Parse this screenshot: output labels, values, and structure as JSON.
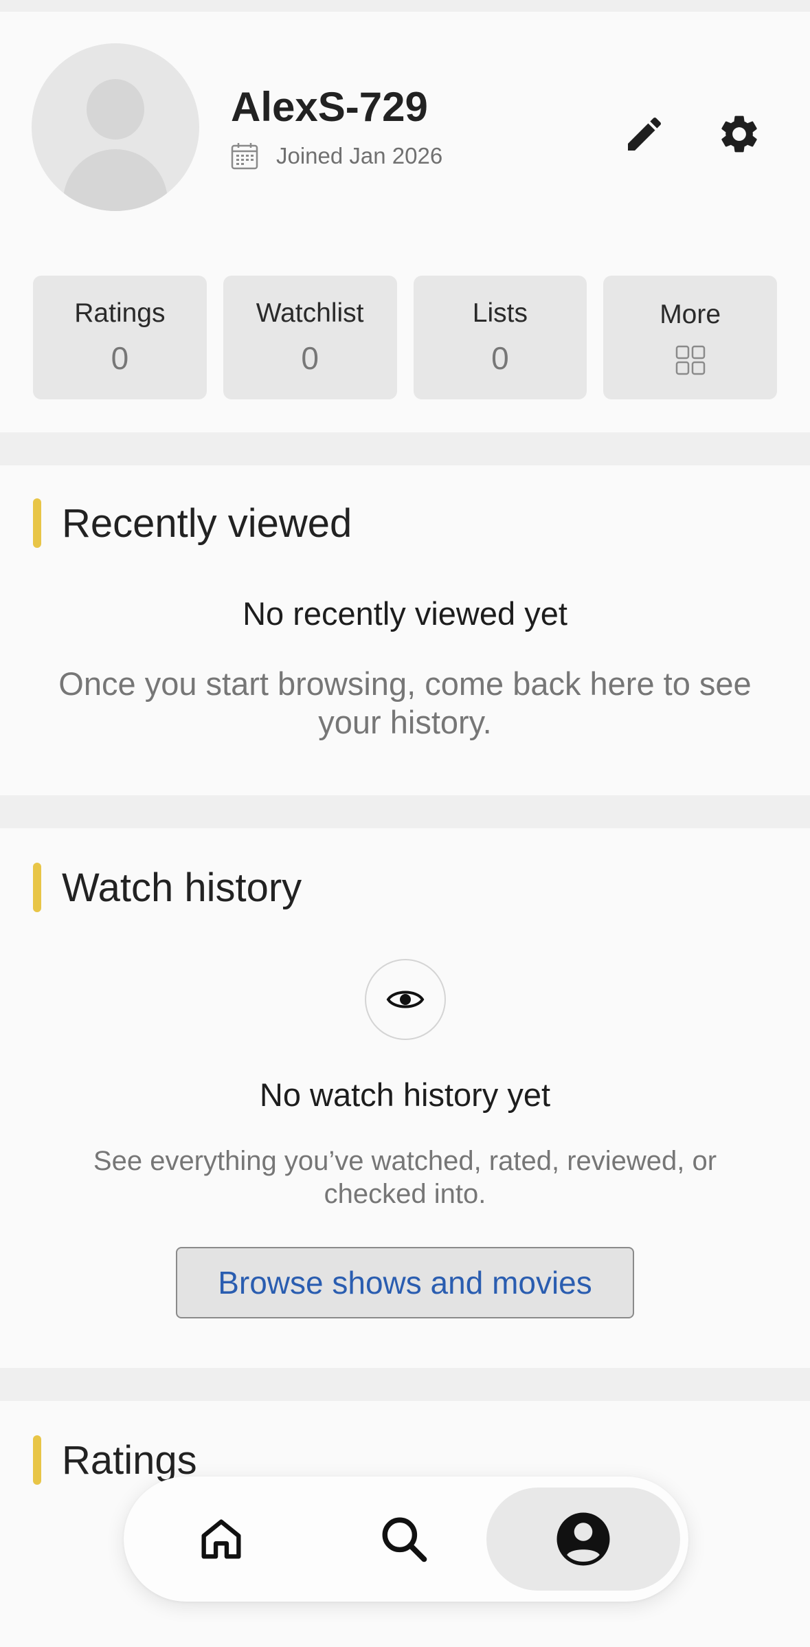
{
  "profile": {
    "username": "AlexS-729",
    "joined": "Joined Jan 2026",
    "icons": {
      "avatar": "person-placeholder-icon",
      "calendar": "calendar-icon",
      "edit": "pencil-icon",
      "settings": "gear-icon"
    }
  },
  "stats": [
    {
      "label": "Ratings",
      "value": "0"
    },
    {
      "label": "Watchlist",
      "value": "0"
    },
    {
      "label": "Lists",
      "value": "0"
    },
    {
      "label": "More",
      "icon": "grid-icon"
    }
  ],
  "recently_viewed": {
    "title": "Recently viewed",
    "empty_title": "No recently viewed yet",
    "empty_desc": "Once you start browsing, come back here to see your history."
  },
  "watch_history": {
    "title": "Watch history",
    "icon": "eye-icon",
    "empty_title": "No watch history yet",
    "empty_desc": "See everything you’ve watched, rated, reviewed, or checked into.",
    "button_label": "Browse shows and movies"
  },
  "ratings_section": {
    "title": "Ratings"
  },
  "bottom_nav": {
    "items": [
      {
        "name": "home",
        "icon": "home-icon"
      },
      {
        "name": "search",
        "icon": "search-icon"
      },
      {
        "name": "profile",
        "icon": "account-circle-icon",
        "active": true
      }
    ]
  },
  "colors": {
    "accent_bar": "#e8c547",
    "link_blue": "#2a5db0",
    "page_bg": "#efefef",
    "card_bg": "#fafafa"
  }
}
